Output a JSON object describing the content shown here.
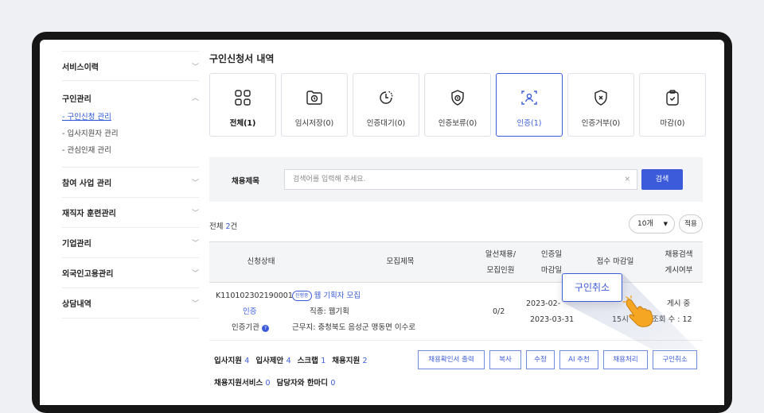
{
  "sidebar": {
    "items": [
      {
        "label": "서비스이력"
      },
      {
        "label": "구인관리",
        "subs": [
          "- 구인신청 관리",
          "- 입사지원자 관리",
          "- 관심인재 관리"
        ]
      },
      {
        "label": "참여 사업 관리"
      },
      {
        "label": "재직자 훈련관리"
      },
      {
        "label": "기업관리"
      },
      {
        "label": "외국인고용관리"
      },
      {
        "label": "상담내역"
      }
    ]
  },
  "main": {
    "title": "구인신청서 내역",
    "cards": [
      {
        "label": "전체(1)",
        "icon": "grid-icon"
      },
      {
        "label": "임시저장(0)",
        "icon": "folder-clock-icon"
      },
      {
        "label": "인증대기(0)",
        "icon": "timer-icon"
      },
      {
        "label": "인증보류(0)",
        "icon": "shield-clock-icon"
      },
      {
        "label": "인증(1)",
        "icon": "user-scan-icon"
      },
      {
        "label": "인증거부(0)",
        "icon": "shield-x-icon"
      },
      {
        "label": "마감(0)",
        "icon": "clipboard-check-icon"
      }
    ],
    "selected_card": "인증(1)"
  },
  "search": {
    "label": "채용제목",
    "placeholder": "검색어를 입력해 주세요.",
    "clear": "×",
    "button": "검색"
  },
  "list": {
    "total_prefix": "전체 ",
    "total_count": "2",
    "total_suffix": "건",
    "per_page": "10개",
    "apply": "적용",
    "headers": {
      "status": "신청상태",
      "title": "모집제목",
      "ratio_line1": "알선채용/",
      "ratio_line2": "모집인원",
      "date_line1": "인증일",
      "date_line2": "마감일",
      "deadline": "접수 마감일",
      "post_line1": "채용검색",
      "post_line2": "게시여부"
    },
    "row": {
      "id": "K110102302190001",
      "status": "인증",
      "agency": "인증기관",
      "progress_badge": "진행중",
      "job_title": "웹 기획자 모집",
      "job_type": "직종: 웹기획",
      "location": "근무지: 충청북도 음성군 맹동면 이수로",
      "ratio": "0/2",
      "cert_date": "2023-02-",
      "close_date": "2023-03-31",
      "deadline": "15시",
      "posted": "게시 중",
      "views": "조회 수 : 12"
    }
  },
  "actions": {
    "stats_row1": [
      {
        "label": "입사지원",
        "count": "4"
      },
      {
        "label": "입사제안",
        "count": "4"
      },
      {
        "label": "스크랩",
        "count": "1"
      },
      {
        "label": "채용지원",
        "count": "2"
      }
    ],
    "stats_row2": [
      {
        "label": "채용지원서비스",
        "count": "0"
      },
      {
        "label": "담당자와 한마디",
        "count": "0"
      }
    ],
    "buttons": [
      "채용확인서 출력",
      "복사",
      "수정",
      "AI 추천",
      "채용처리",
      "구인취소"
    ]
  },
  "tooltip": {
    "label": "구인취소"
  },
  "colors": {
    "accent": "#3b5bdb",
    "frame": "#161616",
    "background": "#eef0f4"
  }
}
